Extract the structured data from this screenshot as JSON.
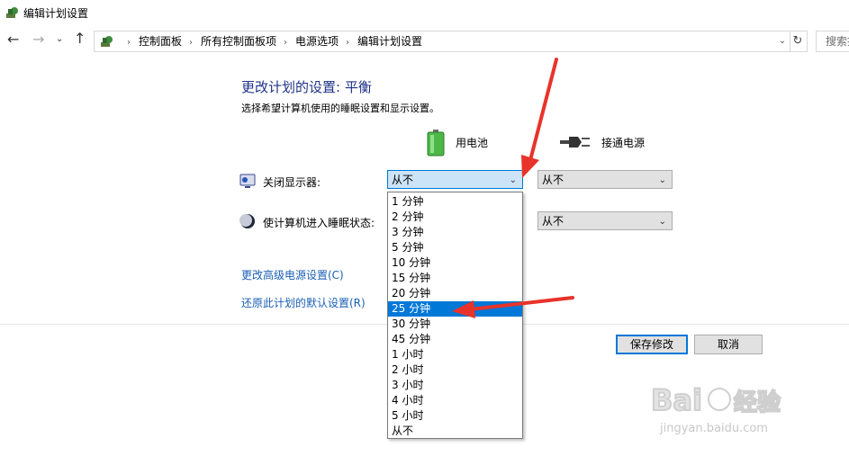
{
  "window": {
    "title": "编辑计划设置"
  },
  "address_bar": {
    "breadcrumb": [
      "控制面板",
      "所有控制面板项",
      "电源选项",
      "编辑计划设置"
    ],
    "search_placeholder": "搜索控"
  },
  "main": {
    "title": "更改计划的设置: 平衡",
    "subtitle": "选择希望计算机使用的睡眠设置和显示设置。",
    "columns": {
      "battery": "用电池",
      "plugged_in": "接通电源"
    },
    "settings": [
      {
        "label": "关闭显示器:",
        "battery_value": "从不",
        "plugged_value": "从不",
        "icon": "display-icon"
      },
      {
        "label": "使计算机进入睡眠状态:",
        "plugged_value": "从不",
        "icon": "sleep-moon-icon"
      }
    ],
    "links": {
      "advanced": "更改高级电源设置(C)",
      "restore": "还原此计划的默认设置(R)"
    },
    "buttons": {
      "save": "保存修改",
      "cancel": "取消"
    }
  },
  "dropdown": {
    "options": [
      "1 分钟",
      "2 分钟",
      "3 分钟",
      "5 分钟",
      "10 分钟",
      "15 分钟",
      "20 分钟",
      "25 分钟",
      "30 分钟",
      "45 分钟",
      "1 小时",
      "2 小时",
      "3 小时",
      "4 小时",
      "5 小时",
      "从不"
    ],
    "highlighted": "25 分钟"
  },
  "colors": {
    "accent": "#0078d7",
    "title": "#1e3287",
    "link": "#1a5fb4",
    "annotation": "#e8332a"
  },
  "watermark": {
    "brand": "Baidu经验",
    "url": "jingyan.baidu.com"
  }
}
